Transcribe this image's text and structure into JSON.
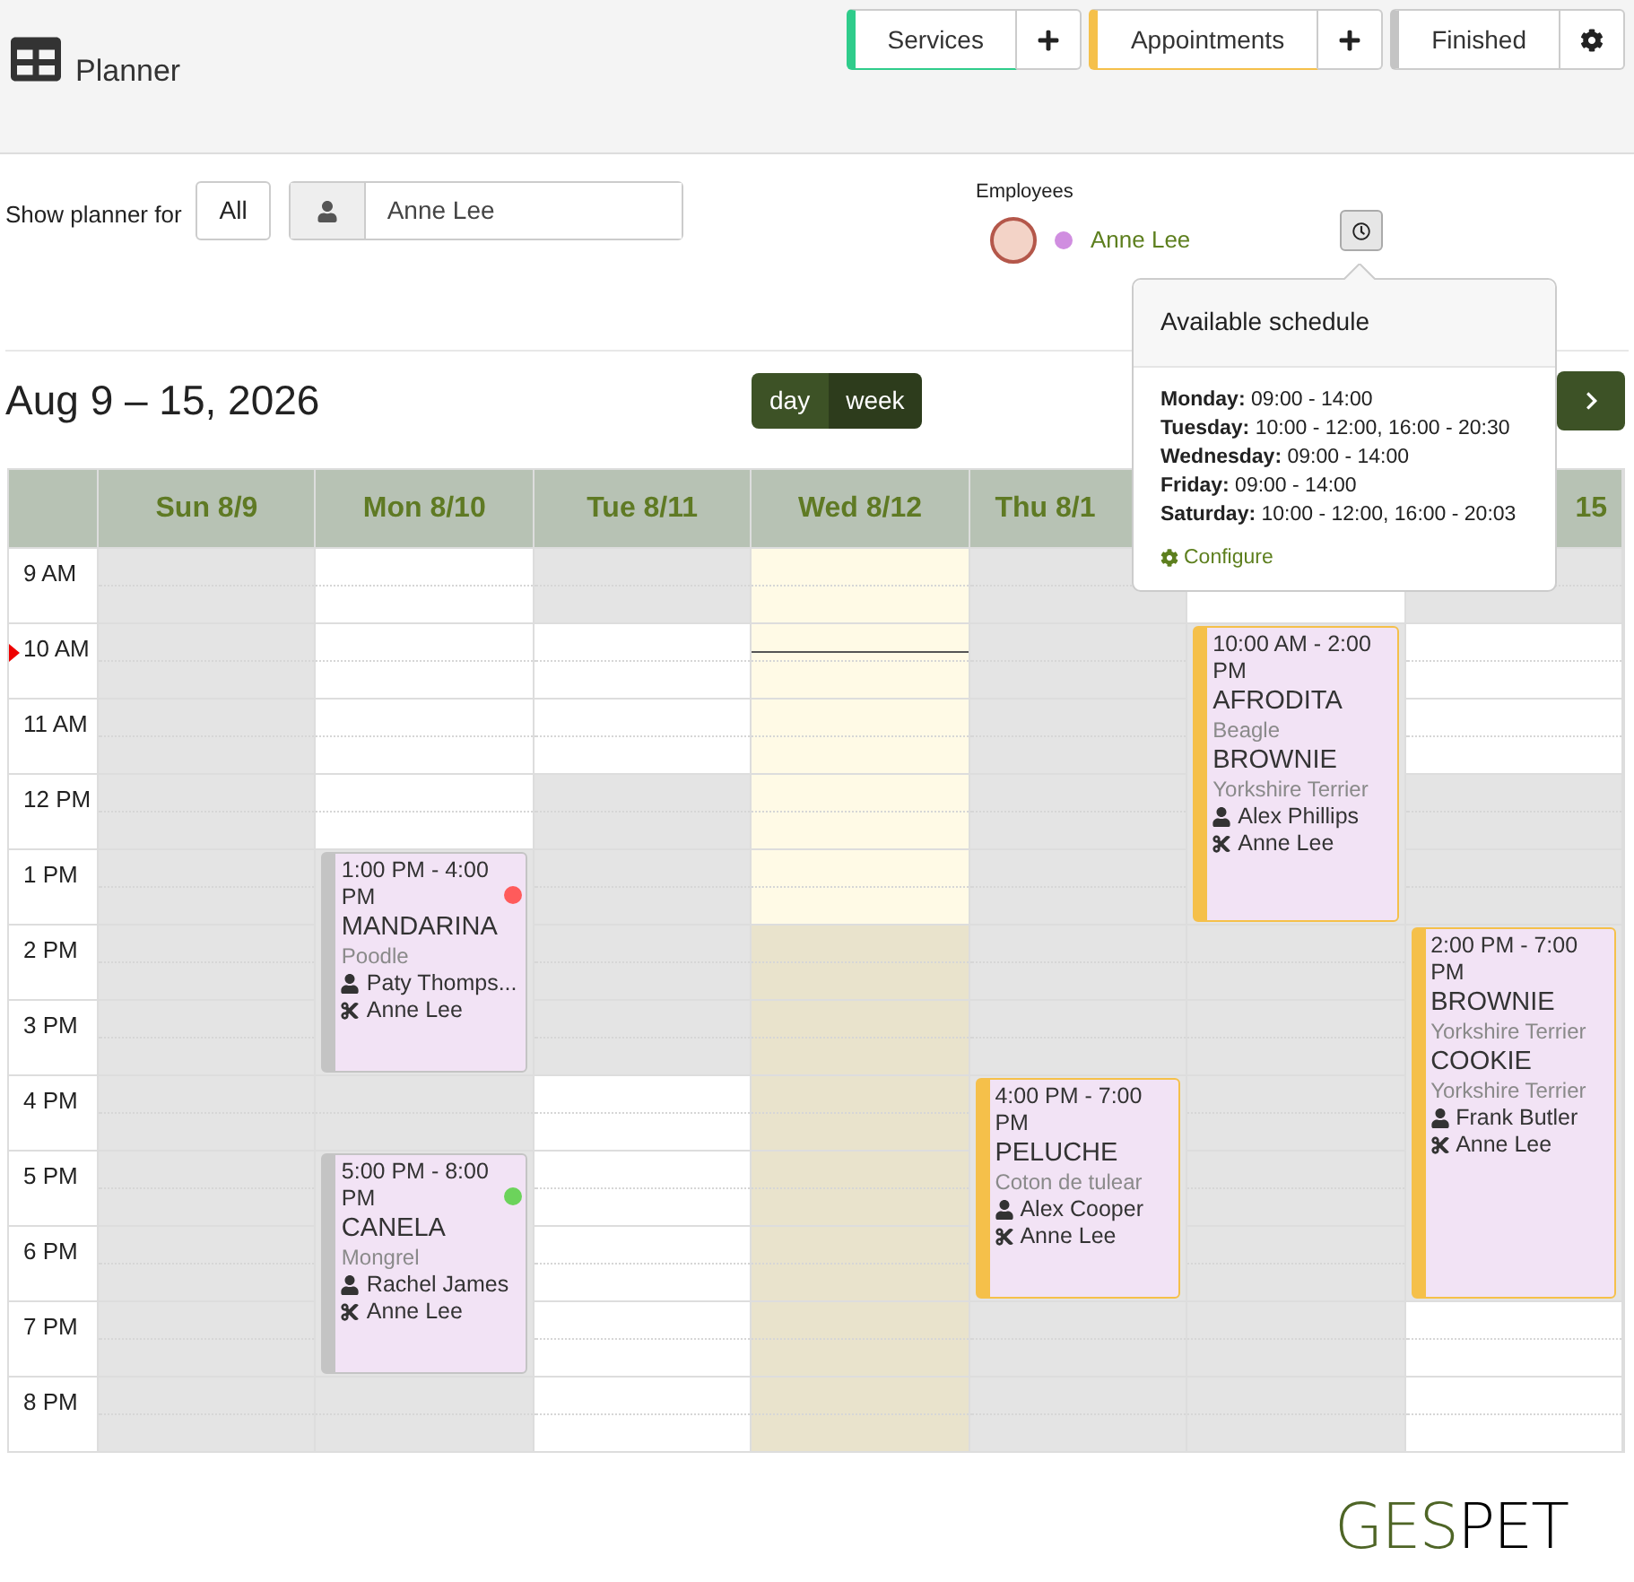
{
  "header": {
    "title": "Planner",
    "actions": [
      {
        "label": "Services",
        "color": "#2fcc8b",
        "kind": "add"
      },
      {
        "label": "Appointments",
        "color": "#f5c04a",
        "kind": "add"
      },
      {
        "label": "Finished",
        "color": "#c4c4c4",
        "kind": "settings"
      }
    ]
  },
  "filter": {
    "label": "Show planner for",
    "all_button": "All",
    "employee_value": "Anne Lee"
  },
  "employees": {
    "title": "Employees",
    "items": [
      {
        "name": "Anne Lee",
        "color": "#d08ee0"
      }
    ]
  },
  "schedule_popup": {
    "title": "Available schedule",
    "rows": [
      {
        "day": "Monday:",
        "hours": "09:00 - 14:00"
      },
      {
        "day": "Tuesday:",
        "hours": "10:00 - 12:00, 16:00 - 20:30"
      },
      {
        "day": "Wednesday:",
        "hours": "09:00 - 14:00"
      },
      {
        "day": "Friday:",
        "hours": "09:00 - 14:00"
      },
      {
        "day": "Saturday:",
        "hours": "10:00 - 12:00, 16:00 - 20:03"
      }
    ],
    "link": "Configure"
  },
  "range_title": "Aug 9 – 15, 2026",
  "views": [
    {
      "label": "day",
      "selected": false
    },
    {
      "label": "week",
      "selected": true
    }
  ],
  "hours": [
    "9 AM",
    "10 AM",
    "11 AM",
    "12 PM",
    "1 PM",
    "2 PM",
    "3 PM",
    "4 PM",
    "5 PM",
    "6 PM",
    "7 PM",
    "8 PM"
  ],
  "days": [
    {
      "label": "Sun 8/9",
      "today": false,
      "slots": [
        {
          "kind": "slot",
          "open": false
        },
        {
          "kind": "slot",
          "open": false
        },
        {
          "kind": "slot",
          "open": false
        },
        {
          "kind": "slot",
          "open": false
        },
        {
          "kind": "slot",
          "open": false
        },
        {
          "kind": "slot",
          "open": false
        },
        {
          "kind": "slot",
          "open": false
        },
        {
          "kind": "slot",
          "open": false
        },
        {
          "kind": "slot",
          "open": false
        },
        {
          "kind": "slot",
          "open": false
        },
        {
          "kind": "slot",
          "open": false
        },
        {
          "kind": "slot",
          "open": false
        }
      ]
    },
    {
      "label": "Mon 8/10",
      "today": false,
      "slots": [
        {
          "kind": "slot",
          "open": true
        },
        {
          "kind": "slot",
          "open": true
        },
        {
          "kind": "slot",
          "open": true
        },
        {
          "kind": "slot",
          "open": true
        },
        {
          "kind": "appointment",
          "time": "1:00 PM - 4:00 PM",
          "color": "#c4c4c4",
          "status_dot": {
            "color": "#ff5b5b"
          },
          "pets": [
            {
              "name": "MANDARINA",
              "breed": "Poodle"
            }
          ],
          "client": "Paty Thomps...",
          "groomer": "Anne Lee"
        },
        {
          "kind": "slot",
          "open": false
        },
        {
          "kind": "appointment",
          "time": "5:00 PM - 8:00 PM",
          "color": "#c4c4c4",
          "status_dot": {
            "color": "#6cd35b"
          },
          "pets": [
            {
              "name": "CANELA",
              "breed": "Mongrel"
            }
          ],
          "client": "Rachel James",
          "groomer": "Anne Lee"
        },
        {
          "kind": "slot",
          "open": false
        }
      ]
    },
    {
      "label": "Tue 8/11",
      "today": false,
      "slots": [
        {
          "kind": "slot",
          "open": false
        },
        {
          "kind": "slot",
          "open": true
        },
        {
          "kind": "slot",
          "open": true
        },
        {
          "kind": "slot",
          "open": false
        },
        {
          "kind": "slot",
          "open": false
        },
        {
          "kind": "slot",
          "open": false
        },
        {
          "kind": "slot",
          "open": false
        },
        {
          "kind": "slot",
          "open": true
        },
        {
          "kind": "slot",
          "open": true
        },
        {
          "kind": "slot",
          "open": true
        },
        {
          "kind": "slot",
          "open": true
        },
        {
          "kind": "slot",
          "open": true
        }
      ]
    },
    {
      "label": "Wed 8/12",
      "today": true,
      "slots": [
        {
          "kind": "slot",
          "open": true
        },
        {
          "kind": "slot",
          "open": true
        },
        {
          "kind": "slot",
          "open": true
        },
        {
          "kind": "slot",
          "open": true
        },
        {
          "kind": "slot",
          "open": true
        },
        {
          "kind": "slot",
          "open": false
        },
        {
          "kind": "slot",
          "open": false
        },
        {
          "kind": "slot",
          "open": false
        },
        {
          "kind": "slot",
          "open": false
        },
        {
          "kind": "slot",
          "open": false
        },
        {
          "kind": "slot",
          "open": false
        },
        {
          "kind": "slot",
          "open": false
        }
      ]
    },
    {
      "label": "Thu 8/1",
      "cut_right": true,
      "today": false,
      "slots": [
        {
          "kind": "slot",
          "open": false
        },
        {
          "kind": "slot",
          "open": false
        },
        {
          "kind": "slot",
          "open": false
        },
        {
          "kind": "slot",
          "open": false
        },
        {
          "kind": "slot",
          "open": false
        },
        {
          "kind": "slot",
          "open": false
        },
        {
          "kind": "slot",
          "open": false
        },
        {
          "kind": "appointment",
          "time": "4:00 PM - 7:00 PM",
          "color": "#f5c04a",
          "pets": [
            {
              "name": "PELUCHE",
              "breed": "Coton de tulear"
            }
          ],
          "client": "Alex Cooper",
          "groomer": "Anne Lee"
        },
        {
          "kind": "slot",
          "open": false
        },
        {
          "kind": "slot",
          "open": false
        }
      ]
    },
    {
      "today": false,
      "slots": [
        {
          "kind": "slot",
          "open": true
        },
        {
          "kind": "appointment",
          "time": "10:00 AM - 2:00 PM",
          "color": "#f5c04a",
          "pets": [
            {
              "name": "AFRODITA",
              "breed": "Beagle"
            },
            {
              "name": "BROWNIE",
              "breed": "Yorkshire Terrier"
            }
          ],
          "client": "Alex Phillips",
          "groomer": "Anne Lee"
        },
        {
          "kind": "slot",
          "open": false
        },
        {
          "kind": "slot",
          "open": false
        },
        {
          "kind": "slot",
          "open": false
        },
        {
          "kind": "slot",
          "open": false
        },
        {
          "kind": "slot",
          "open": false
        },
        {
          "kind": "slot",
          "open": false
        },
        {
          "kind": "slot",
          "open": false
        }
      ]
    },
    {
      "label": "15",
      "cut_left": true,
      "today": false,
      "slots": [
        {
          "kind": "slot",
          "open": false
        },
        {
          "kind": "slot",
          "open": true
        },
        {
          "kind": "slot",
          "open": true
        },
        {
          "kind": "slot",
          "open": false
        },
        {
          "kind": "slot",
          "open": false
        },
        {
          "kind": "appointment",
          "time": "2:00 PM - 7:00 PM",
          "color": "#f5c04a",
          "pets": [
            {
              "name": "BROWNIE",
              "breed": "Yorkshire Terrier"
            },
            {
              "name": "COOKIE",
              "breed": "Yorkshire Terrier"
            }
          ],
          "client": "Frank Butler",
          "groomer": "Anne Lee"
        },
        {
          "kind": "slot",
          "open": true
        },
        {
          "kind": "slot",
          "open": true
        }
      ]
    }
  ],
  "logo": {
    "parts": [
      "GES",
      "PET"
    ]
  }
}
